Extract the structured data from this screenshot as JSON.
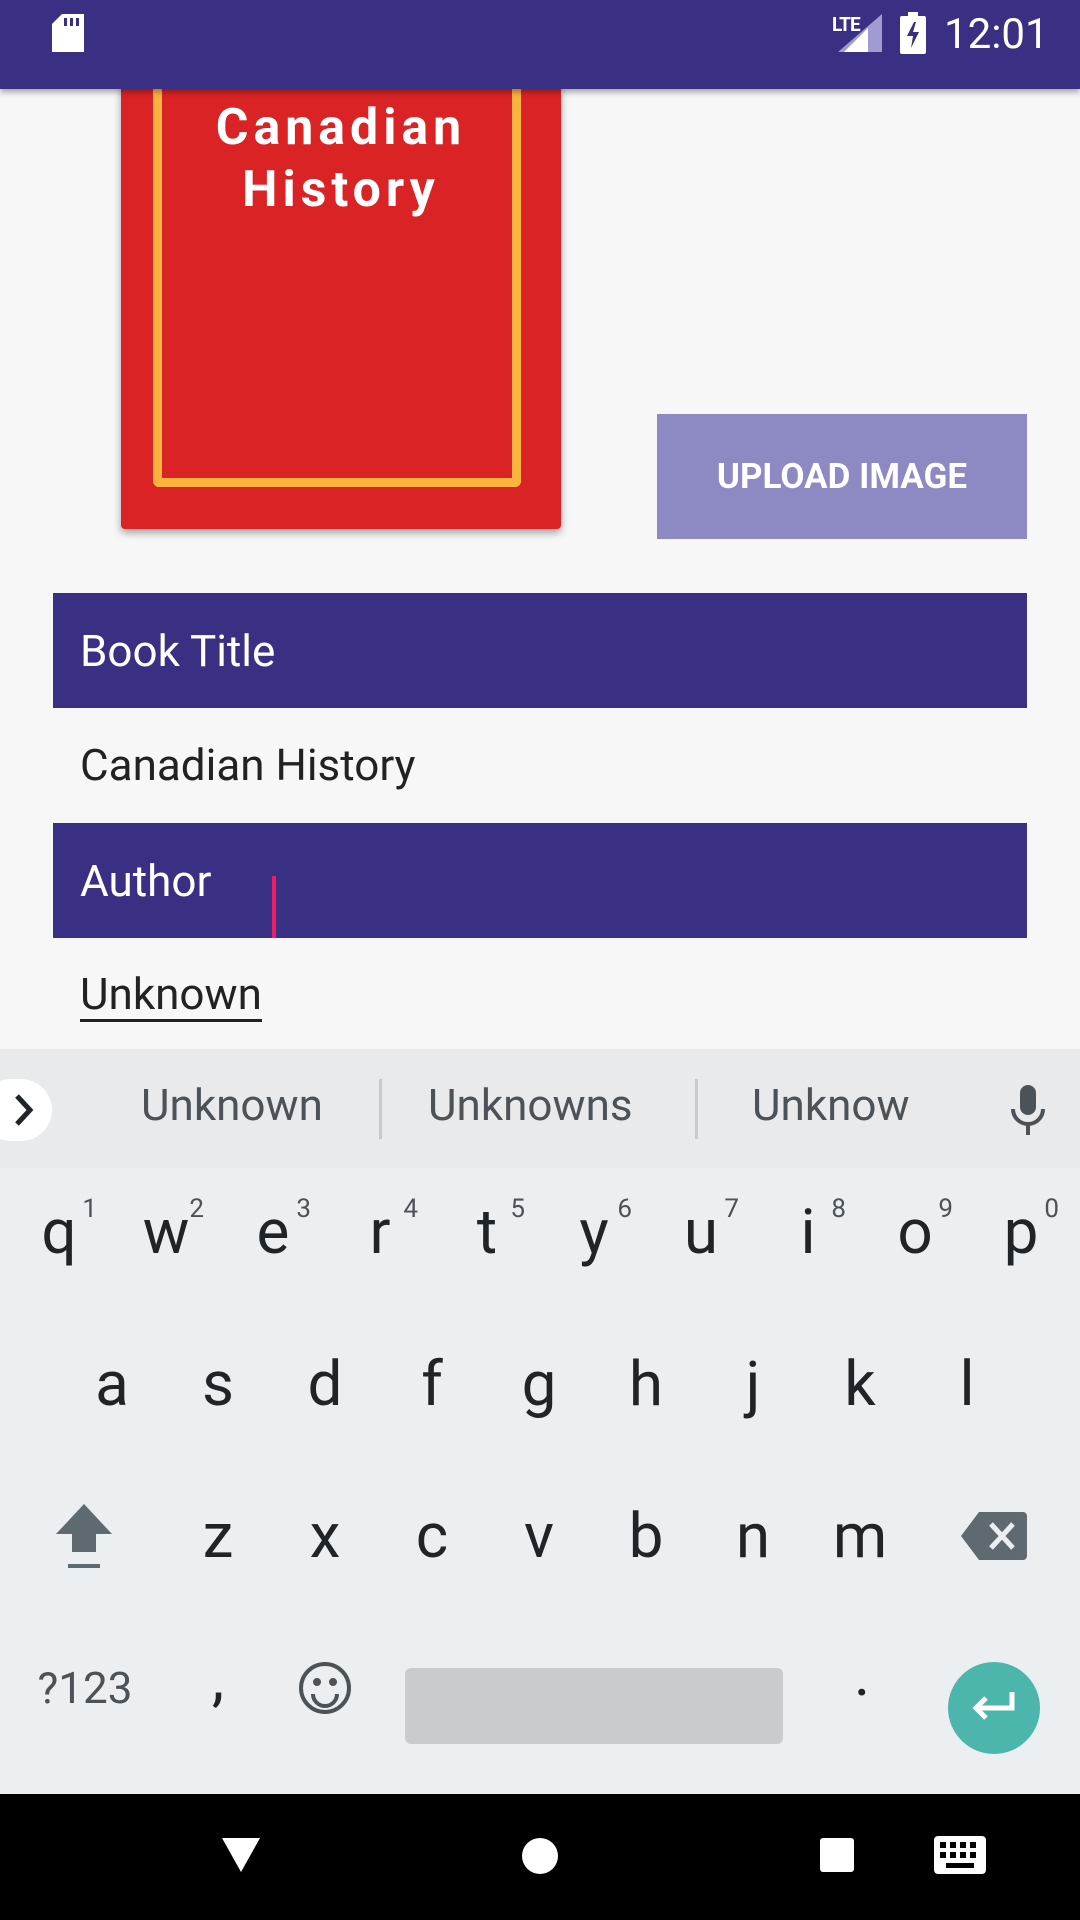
{
  "status_bar": {
    "time": "12:01",
    "network": "LTE"
  },
  "cover": {
    "title": "Canadian\nHistory"
  },
  "upload_button": "UPLOAD IMAGE",
  "form": {
    "title_label": "Book Title",
    "title_value": "Canadian History",
    "author_label": "Author",
    "author_value": "Unknown"
  },
  "suggestions": [
    "Unknown",
    "Unknowns",
    "Unknow"
  ],
  "keyboard": {
    "row1": [
      {
        "key": "q",
        "hint": "1"
      },
      {
        "key": "w",
        "hint": "2"
      },
      {
        "key": "e",
        "hint": "3"
      },
      {
        "key": "r",
        "hint": "4"
      },
      {
        "key": "t",
        "hint": "5"
      },
      {
        "key": "y",
        "hint": "6"
      },
      {
        "key": "u",
        "hint": "7"
      },
      {
        "key": "i",
        "hint": "8"
      },
      {
        "key": "o",
        "hint": "9"
      },
      {
        "key": "p",
        "hint": "0"
      }
    ],
    "row2": [
      "a",
      "s",
      "d",
      "f",
      "g",
      "h",
      "j",
      "k",
      "l"
    ],
    "row3": [
      "z",
      "x",
      "c",
      "v",
      "b",
      "n",
      "m"
    ],
    "symbols": "?123",
    "comma": ",",
    "period": "."
  },
  "colors": {
    "primary": "#3a3083",
    "accent": "#8c89c3",
    "caret": "#e91e63",
    "enter": "#4db6ac",
    "cover_red": "#da2325",
    "cover_frame": "#fbb33f"
  }
}
